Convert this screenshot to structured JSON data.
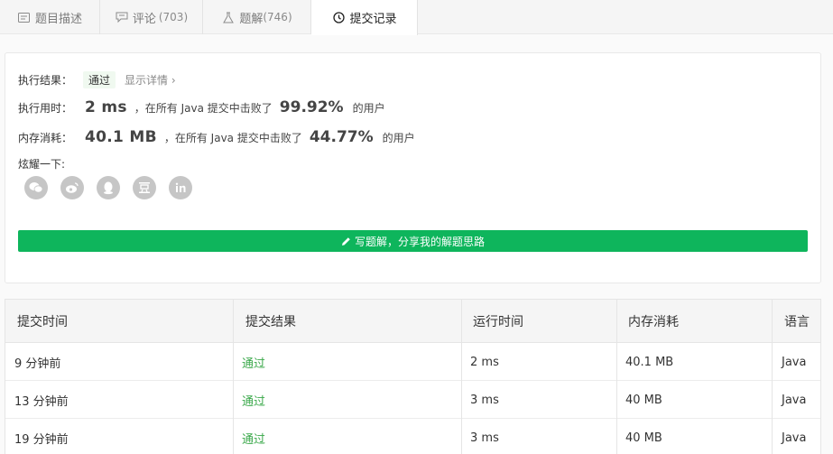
{
  "tabs": [
    {
      "label": "题目描述",
      "count": ""
    },
    {
      "label": "评论",
      "count": "(703)"
    },
    {
      "label": "题解",
      "count": "(746)"
    },
    {
      "label": "提交记录",
      "count": ""
    }
  ],
  "result": {
    "status_label": "执行结果：",
    "status_value": "通过",
    "detail_link": "显示详情 ›",
    "time_label": "执行用时：",
    "time_value": "2 ms",
    "time_mid": "，在所有 Java 提交中击败了",
    "time_pct": "99.92%",
    "time_tail": "的用户",
    "mem_label": "内存消耗：",
    "mem_value": "40.1 MB",
    "mem_mid": "，在所有 Java 提交中击败了",
    "mem_pct": "44.77%",
    "mem_tail": "的用户",
    "share_label": "炫耀一下:",
    "share_icons": [
      "wechat-icon",
      "weibo-icon",
      "qq-icon",
      "douban-icon",
      "linkedin-icon"
    ],
    "write_button": "写题解，分享我的解题思路"
  },
  "table": {
    "headers": [
      "提交时间",
      "提交结果",
      "运行时间",
      "内存消耗",
      "语言"
    ],
    "rows": [
      [
        "9 分钟前",
        "通过",
        "2 ms",
        "40.1 MB",
        "Java"
      ],
      [
        "13 分钟前",
        "通过",
        "3 ms",
        "40 MB",
        "Java"
      ],
      [
        "19 分钟前",
        "通过",
        "3 ms",
        "40 MB",
        "Java"
      ]
    ]
  },
  "colors": {
    "accent": "#0eb55c",
    "pass": "#3aa84a"
  }
}
